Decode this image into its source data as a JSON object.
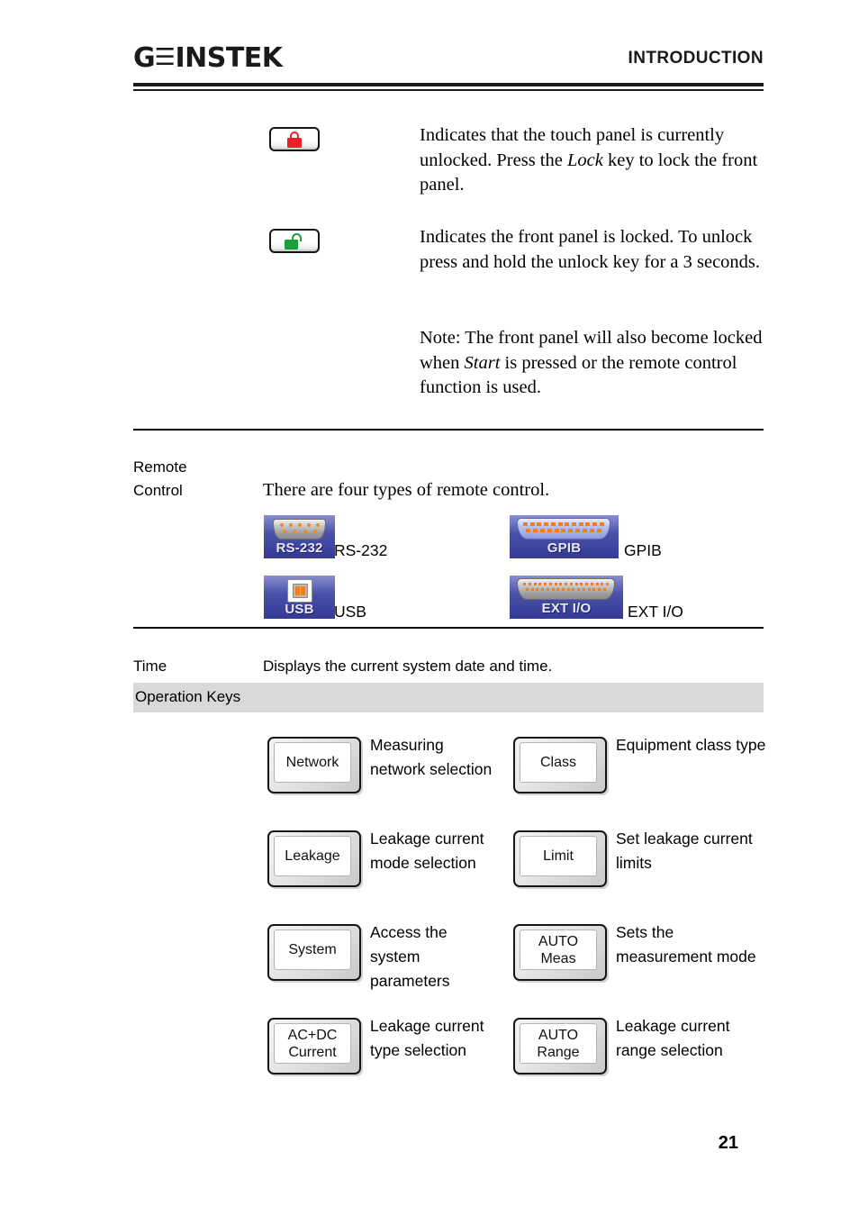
{
  "header": {
    "logo_gw": "G",
    "logo_w": "☰",
    "logo_instek": "INSTEK",
    "title": "INTRODUCTION"
  },
  "lock_rows": [
    {
      "icon": "padlock-closed-red-icon",
      "text_parts": [
        {
          "text": "Indicates that the touch panel is currently unlocked. Press the ",
          "style": "normal"
        },
        {
          "text": "Lock",
          "style": "italic"
        },
        {
          "text": " key to lock the front panel.",
          "style": "normal"
        }
      ]
    },
    {
      "icon": "padlock-open-green-icon",
      "text_parts": [
        {
          "text": "Indicates the front panel is locked. To unlock press and hold the unlock key for a 3 seconds.",
          "style": "normal"
        }
      ]
    }
  ],
  "lock_note": {
    "prefix": "Note: The front panel will also become locked when ",
    "italic": "Start",
    "suffix": " is pressed or the remote control function is used."
  },
  "remote_control": {
    "label_line1": "Remote",
    "label_line2": "Control",
    "description": "There are four types of remote control.",
    "interfaces": [
      {
        "icon_text": "RS-232",
        "caption": "RS-232",
        "icon_name": "rs232-connector-icon"
      },
      {
        "icon_text": "GPIB",
        "caption": "GPIB",
        "icon_name": "gpib-connector-icon"
      },
      {
        "icon_text": "USB",
        "caption": "USB",
        "icon_name": "usb-connector-icon"
      },
      {
        "icon_text": "EXT I/O",
        "caption": "EXT I/O",
        "icon_name": "ext-io-connector-icon"
      }
    ]
  },
  "time_row": {
    "label": "Time",
    "description": "Displays the current system date and time."
  },
  "operation_keys": {
    "section_title": "Operation Keys",
    "keys": [
      {
        "line1": "Network",
        "line2": "",
        "desc": "Measuring network selection",
        "name": "network-key"
      },
      {
        "line1": "Class",
        "line2": "",
        "desc": "Equipment class type",
        "name": "class-key"
      },
      {
        "line1": "Leakage",
        "line2": "",
        "desc": "Leakage current mode selection",
        "name": "leakage-key"
      },
      {
        "line1": "Limit",
        "line2": "",
        "desc": "Set leakage current limits",
        "name": "limit-key"
      },
      {
        "line1": "System",
        "line2": "",
        "desc": "Access the system parameters",
        "name": "system-key"
      },
      {
        "line1": "AUTO",
        "line2": "Meas",
        "desc": "Sets the measurement mode",
        "name": "auto-meas-key"
      },
      {
        "line1": "AC+DC",
        "line2": "Current",
        "desc": "Leakage current type selection",
        "name": "ac-dc-current-key"
      },
      {
        "line1": "AUTO",
        "line2": "Range",
        "desc": "Leakage current range selection",
        "name": "auto-range-key"
      }
    ]
  },
  "footer": {
    "page_number": "21"
  },
  "colors": {
    "lock_closed": "#ee1c25",
    "lock_open": "#1aa03a",
    "connector_blue": "#4a51a8",
    "connector_pin": "#ef7f22",
    "band_gray": "#d9d9d9"
  }
}
